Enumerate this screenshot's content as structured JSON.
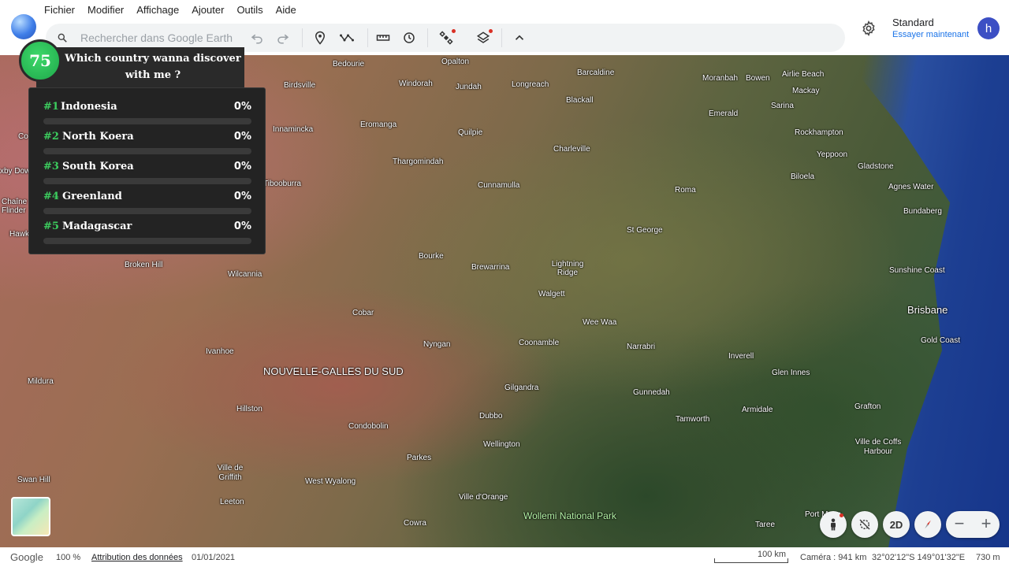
{
  "menu": [
    "Fichier",
    "Modifier",
    "Affichage",
    "Ajouter",
    "Outils",
    "Aide"
  ],
  "search": {
    "placeholder": "Rechercher dans Google Earth"
  },
  "toolbar_icons": [
    "undo-icon",
    "redo-icon",
    "placemark-icon",
    "path-icon",
    "ruler-icon",
    "history-icon",
    "satellite-icon",
    "layers-icon",
    "chevron-up-icon"
  ],
  "account": {
    "plan_title": "Standard",
    "plan_link": "Essayer maintenant",
    "avatar_letter": "h"
  },
  "quiz": {
    "score": "75",
    "title": "Which country wanna discover with me ?",
    "rankings": [
      {
        "num": "#1",
        "name": "Indonesia",
        "pct": "0%",
        "value": 0
      },
      {
        "num": "#2",
        "name": "North Koera",
        "pct": "0%",
        "value": 0
      },
      {
        "num": "#3",
        "name": "South Korea",
        "pct": "0%",
        "value": 0
      },
      {
        "num": "#4",
        "name": "Greenland",
        "pct": "0%",
        "value": 0
      },
      {
        "num": "#5",
        "name": "Madagascar",
        "pct": "0%",
        "value": 0
      }
    ]
  },
  "map_labels": {
    "bedourie": "Bedourie",
    "opalton": "Opalton",
    "barcaldine": "Barcaldine",
    "moranbah": "Moranbah",
    "bowen": "Bowen",
    "airlie_beach": "Airlie Beach",
    "mackay": "Mackay",
    "sarina": "Sarina",
    "birdsville": "Birdsville",
    "windorah": "Windorah",
    "jundah": "Jundah",
    "longreach": "Longreach",
    "blackall": "Blackall",
    "emerald": "Emerald",
    "innamincka": "Innamincka",
    "eromanga": "Eromanga",
    "quilpie": "Quilpie",
    "rockhampton": "Rockhampton",
    "yeppoon": "Yeppoon",
    "charleville": "Charleville",
    "thargomindah": "Thargomindah",
    "gladstone": "Gladstone",
    "biloela": "Biloela",
    "agnes_water": "Agnes Water",
    "tibooburra": "Tibooburra",
    "cunnamulla": "Cunnamulla",
    "roma": "Roma",
    "bundaberg": "Bundaberg",
    "st_george": "St George",
    "bourke": "Bourke",
    "brewarrina": "Brewarrina",
    "lightning_ridge": "Lightning Ridge",
    "sunshine_coast": "Sunshine Coast",
    "broken_hill": "Broken Hill",
    "wilcannia": "Wilcannia",
    "walgett": "Walgett",
    "brisbane": "Brisbane",
    "cobar": "Cobar",
    "wee_waa": "Wee Waa",
    "gold_coast": "Gold Coast",
    "nyngan": "Nyngan",
    "coonamble": "Coonamble",
    "narrabri": "Narrabri",
    "ivanhoe": "Ivanhoe",
    "inverell": "Inverell",
    "nsw": "NOUVELLE-GALLES DU SUD",
    "glen_innes": "Glen Innes",
    "mildura": "Mildura",
    "gilgandra": "Gilgandra",
    "gunnedah": "Gunnedah",
    "hillston": "Hillston",
    "armidale": "Armidale",
    "grafton": "Grafton",
    "dubbo": "Dubbo",
    "tamworth": "Tamworth",
    "condobolin": "Condobolin",
    "wellington": "Wellington",
    "coffs_harbour": "Ville de Coffs Harbour",
    "parkes": "Parkes",
    "griffith": "Ville de Griffith",
    "swan_hill": "Swan Hill",
    "west_wyalong": "West Wyalong",
    "orange": "Ville d'Orange",
    "leeton": "Leeton",
    "wollemi": "Wollemi National Park",
    "cowra": "Cowra",
    "taree": "Taree",
    "port_macquarie": "Port Macq",
    "chaine_flinders": "Chaîne Flinder",
    "oxley": "xby Down",
    "hawk": "Hawk",
    "coo": "Co"
  },
  "controls": {
    "mode_2d": "2D"
  },
  "status": {
    "logo": "Google",
    "zoom": "100 %",
    "attribution": "Attribution des données",
    "date": "01/01/2021",
    "scale": "100 km",
    "camera": "Caméra : 941 km",
    "coords": "32°02'12\"S 149°01'32\"E",
    "altitude": "730 m"
  },
  "colors": {
    "accent_green": "#3ccc5e",
    "link_blue": "#1a73e8",
    "avatar_bg": "#3c4fc4",
    "panel_bg": "#232323"
  }
}
